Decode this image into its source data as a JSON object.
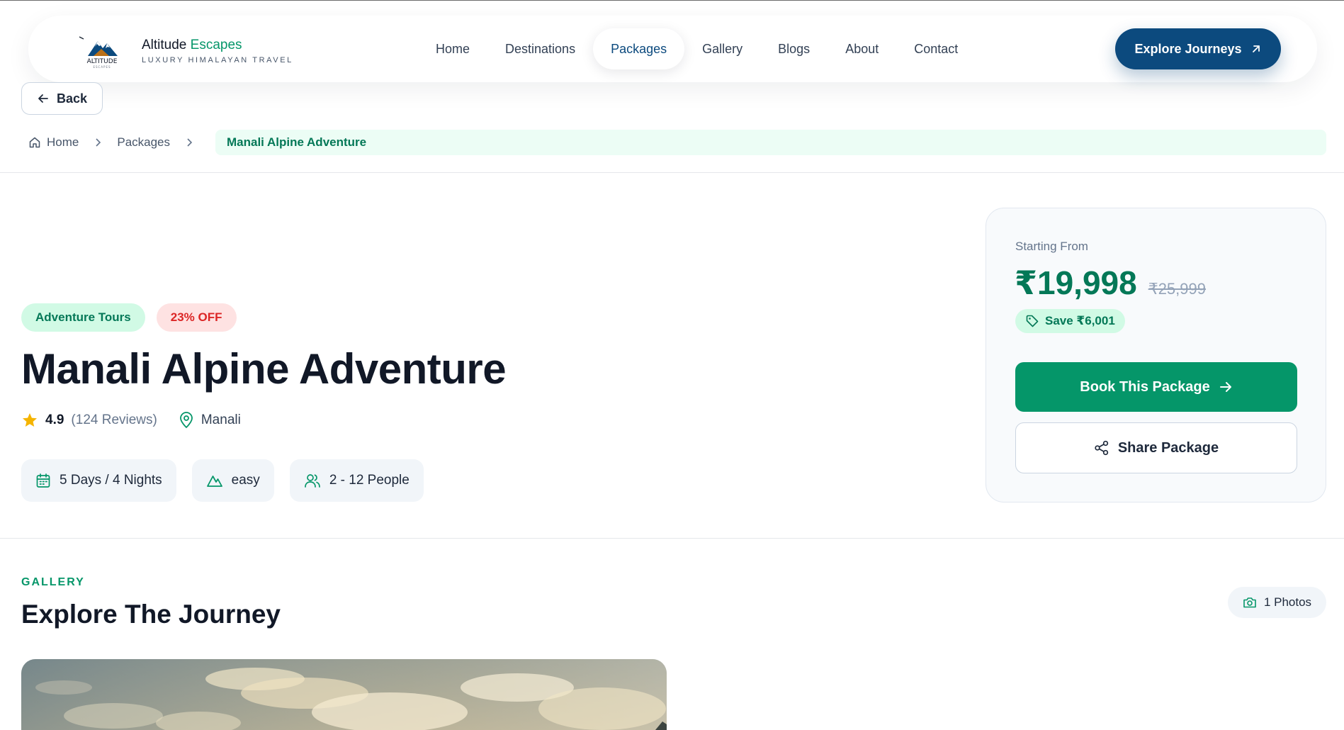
{
  "brand": {
    "name_part1": "Altitude",
    "name_part2": "Escapes",
    "tagline": "LUXURY HIMALAYAN TRAVEL",
    "logo_text": "ALTITUDE",
    "logo_subtext": "ESCAPES"
  },
  "nav": {
    "links": [
      {
        "label": "Home",
        "active": false
      },
      {
        "label": "Destinations",
        "active": false
      },
      {
        "label": "Packages",
        "active": true
      },
      {
        "label": "Gallery",
        "active": false
      },
      {
        "label": "Blogs",
        "active": false
      },
      {
        "label": "About",
        "active": false
      },
      {
        "label": "Contact",
        "active": false
      }
    ],
    "cta_label": "Explore Journeys"
  },
  "back_label": "Back",
  "breadcrumb": {
    "home": "Home",
    "packages": "Packages",
    "current": "Manali Alpine Adventure"
  },
  "package": {
    "category": "Adventure Tours",
    "discount": "23% OFF",
    "title": "Manali Alpine Adventure",
    "rating": "4.9",
    "reviews": "(124 Reviews)",
    "location": "Manali",
    "duration": "5 Days / 4 Nights",
    "difficulty": "easy",
    "group_size": "2 - 12 People"
  },
  "pricing": {
    "label": "Starting From",
    "price": "₹19,998",
    "original_price": "₹25,999",
    "savings": "Save ₹6,001",
    "book_label": "Book This Package",
    "share_label": "Share Package"
  },
  "gallery": {
    "eyebrow": "GALLERY",
    "title": "Explore The Journey",
    "photo_count": "1 Photos"
  },
  "colors": {
    "primary_navy": "#0c4a7e",
    "accent_green": "#059669",
    "badge_red": "#dc2626",
    "star": "#f5b400"
  },
  "icons": [
    "arrow-up-right-icon",
    "arrow-left-icon",
    "home-icon",
    "chevron-right-icon",
    "star-icon",
    "map-pin-icon",
    "calendar-icon",
    "mountain-icon",
    "users-icon",
    "tag-icon",
    "arrow-right-icon",
    "share-icon",
    "camera-icon"
  ]
}
